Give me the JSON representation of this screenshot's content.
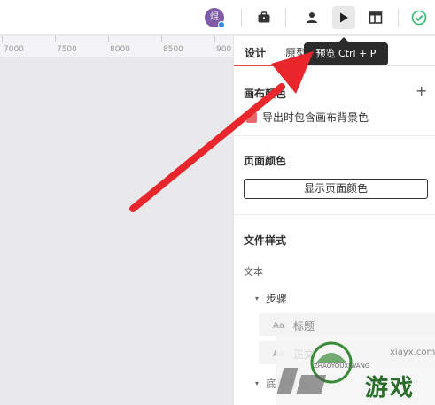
{
  "toolbar": {
    "avatar_text": "焜",
    "icons": [
      "briefcase-icon",
      "user-icon",
      "play-icon",
      "layout-icon",
      "check-circle-icon"
    ]
  },
  "ruler": {
    "ticks": [
      "7000",
      "7500",
      "8000",
      "8500",
      "900"
    ]
  },
  "tooltip": {
    "text": "预览 Ctrl + P"
  },
  "panel": {
    "tabs": [
      {
        "label": "设计",
        "active": true
      },
      {
        "label": "原型",
        "active": false
      }
    ],
    "canvas_section": {
      "title": "画布颜色",
      "checkbox_label": "导出时包含画布背景色"
    },
    "page_color": {
      "title": "页面颜色",
      "button_label": "显示页面颜色"
    },
    "file_styles": {
      "title": "文件样式",
      "text_label": "文本",
      "group_label": "步骤",
      "item1": "标题",
      "item1_prefix": "Aa",
      "item2": "正文",
      "item2_prefix": "Aa",
      "group2_label": "底部导航"
    }
  },
  "watermark": {
    "main": "游戏",
    "sub": "ZHAOYOUXIWANG",
    "url": "xiayx.com"
  },
  "colors": {
    "accent": "#e54545",
    "arrow": "#e8262b",
    "success": "#2fb96a"
  }
}
